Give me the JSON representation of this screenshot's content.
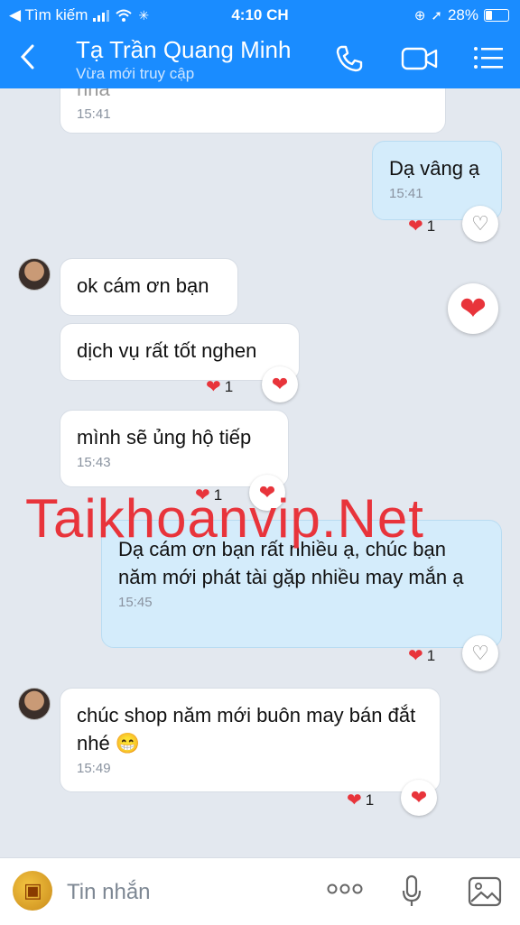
{
  "status_bar": {
    "carrier": "◀ Tìm kiếm",
    "time": "4:10 CH",
    "battery": "28%"
  },
  "header": {
    "back_icon": "chevron-left-icon",
    "title": "Tạ Trần Quang Minh",
    "subtitle": "Vừa mới truy cập"
  },
  "messages": {
    "m0": {
      "text": "nha",
      "time": "15:41"
    },
    "m1": {
      "text": "Dạ vâng ạ",
      "time": "15:41",
      "reaction_count": "1"
    },
    "m2": {
      "text": "ok cám ơn bạn"
    },
    "m3": {
      "text": "dịch vụ rất tốt nghen",
      "reaction_count": "1"
    },
    "m4": {
      "text": "mình sẽ ủng hộ tiếp",
      "time": "15:43",
      "reaction_count": "1"
    },
    "m5": {
      "text": "Dạ cám ơn bạn rất nhiều ạ, chúc bạn năm mới phát tài gặp nhiều may mắn ạ",
      "time": "15:45",
      "reaction_count": "1"
    },
    "m6": {
      "text": "chúc shop năm mới buôn may bán đắt nhé 😁",
      "time": "15:49",
      "reaction_count": "1"
    }
  },
  "watermark": "Taikhoanvip.Net",
  "input": {
    "placeholder": "Tin nhắn"
  },
  "colors": {
    "brand": "#1a8cff",
    "heart": "#e8343b"
  }
}
